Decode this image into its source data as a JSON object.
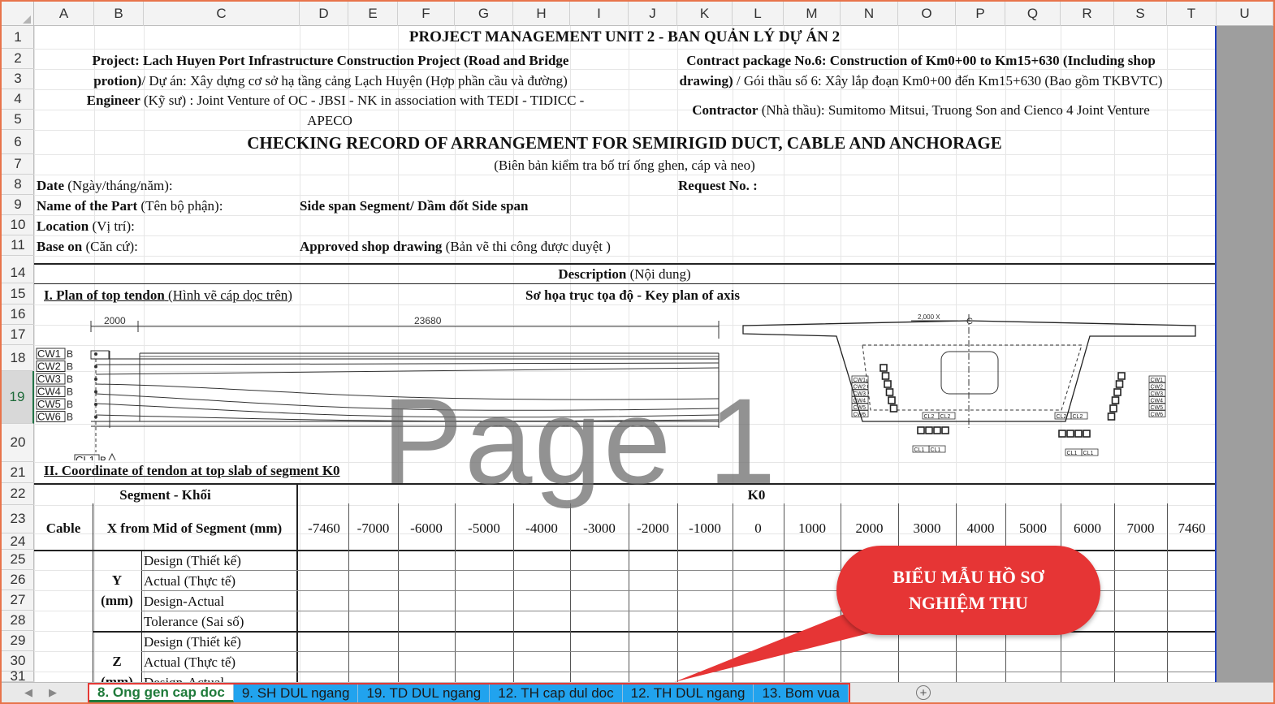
{
  "columns": [
    "A",
    "B",
    "C",
    "D",
    "E",
    "F",
    "G",
    "H",
    "I",
    "J",
    "K",
    "L",
    "M",
    "N",
    "O",
    "P",
    "Q",
    "R",
    "S",
    "T",
    "U"
  ],
  "rows": [
    "1",
    "2",
    "3",
    "4",
    "5",
    "6",
    "7",
    "8",
    "9",
    "10",
    "11",
    "14",
    "15",
    "16",
    "17",
    "18",
    "19",
    "20",
    "21",
    "22",
    "23",
    "24",
    "25",
    "26",
    "27",
    "28",
    "29",
    "30",
    "31"
  ],
  "header": {
    "unit": "PROJECT MANAGEMENT UNIT 2 - BAN QUẢN LÝ DỰ ÁN 2",
    "project_label": "Project",
    "project_line1": ": Lach Huyen Port Infrastructure Construction Project (Road and Bridge",
    "project_line2a": "protion)",
    "project_line2b": "/ Dự án:  Xây dựng cơ sở hạ tầng cảng Lạch Huyện (Hợp phần cầu và đường)",
    "contract_line1": "Contract package No.6: Construction of Km0+00 to Km15+630 (Including shop",
    "contract_line2a": "drawing)",
    "contract_line2b": " / Gói thầu số 6: Xây lắp đoạn Km0+00 đến Km15+630 (Bao gồm TKBVTC)",
    "engineer_label": "Engineer",
    "engineer_line1": " (Kỹ sư) : Joint Venture of OC - JBSI - NK in association with TEDI - TIDICC -",
    "engineer_line2": "APECO",
    "contractor_label": "Contractor",
    "contractor_text": " (Nhà thầu): Sumitomo Mitsui, Truong Son and Cienco 4 Joint Venture",
    "record_title": "CHECKING RECORD OF  ARRANGEMENT FOR SEMIRIGID DUCT, CABLE AND ANCHORAGE",
    "record_subtitle": "(Biên bản kiểm tra bố trí ống ghen, cáp và neo)"
  },
  "fields": {
    "date_label": "Date",
    "date_sub": " (Ngày/tháng/năm):",
    "request_label": "Request No. :",
    "part_label": "Name of the Part",
    "part_sub": " (Tên bộ phận):",
    "part_value": "Side span Segment/ Dầm đốt Side span",
    "location_label": "Location",
    "location_sub": " (Vị trí):",
    "base_label": "Base on",
    "base_sub": " (Căn cứ):",
    "base_value_bold": "Approved shop drawing",
    "base_value_rest": " (Bản vẽ thi công được duyệt )"
  },
  "description": {
    "label": "Description",
    "sub": " (Nội dung)",
    "plan_title": "I. Plan of top tendon",
    "plan_sub": " (Hình vẽ cáp dọc trên)",
    "key_plan": "Sơ họa trục tọa độ - Key plan of axis",
    "coord_title": "II. Coordinate of tendon at top slab of segment K0"
  },
  "drawing": {
    "dim_2000": "2000",
    "dim_23680": "23680",
    "cables": [
      "CW1",
      "CW2",
      "CW3",
      "CW4",
      "CW5",
      "CW6"
    ],
    "cl": [
      "CL1",
      "CL2"
    ],
    "b_mark": "B",
    "section_dim": "2,000 X",
    "axis_mark": "C",
    "cw_left": [
      "CW1",
      "CW2",
      "CW3",
      "CW4",
      "CW5",
      "CW6"
    ],
    "cw_right": [
      "CW1",
      "CW2",
      "CW3",
      "CW4",
      "CW5",
      "CW6"
    ],
    "cl_small": [
      "CL2",
      "CL2",
      "CL1",
      "CL1",
      "CL2",
      "CL2",
      "CL1",
      "CL1"
    ]
  },
  "table": {
    "segment_label": "Segment - Khối",
    "segment_value": "K0",
    "cable_label": "Cable",
    "x_label": "X from Mid of Segment (mm)",
    "x_values": [
      "-7460",
      "-7000",
      "-6000",
      "-5000",
      "-4000",
      "-3000",
      "-2000",
      "-1000",
      "0",
      "1000",
      "2000",
      "3000",
      "4000",
      "5000",
      "6000",
      "7000",
      "7460"
    ],
    "y_label1": "Y",
    "y_label2": "(mm)",
    "z_label": "Z",
    "z_label2": "(mm)",
    "rows_y": [
      "Design (Thiết kế)",
      "Actual (Thực tế)",
      "Design-Actual",
      "Tolerance (Sai số)"
    ],
    "rows_z": [
      "Design (Thiết kế)",
      "Actual (Thực tế)",
      "Design-Actual"
    ]
  },
  "watermark": "Page 1",
  "callout": {
    "line1": "BIỂU MẪU HỒ SƠ",
    "line2": "NGHIỆM THU",
    "color": "#e63535"
  },
  "tabs": [
    {
      "label": "8. Ong gen cap doc",
      "active": true
    },
    {
      "label": "9. SH DUL ngang",
      "active": false
    },
    {
      "label": "19. TD DUL ngang",
      "active": false
    },
    {
      "label": "12. TH cap dul doc",
      "active": false
    },
    {
      "label": "12. TH DUL ngang",
      "active": false
    },
    {
      "label": "13. Bom vua",
      "active": false
    }
  ],
  "tab_nav": {
    "prev": "◀",
    "next": "▶",
    "add": "+"
  },
  "colors": {
    "tab_blue": "#21a3ee",
    "active_tab_text": "#1f7a3a",
    "frame": "#e8744b"
  }
}
